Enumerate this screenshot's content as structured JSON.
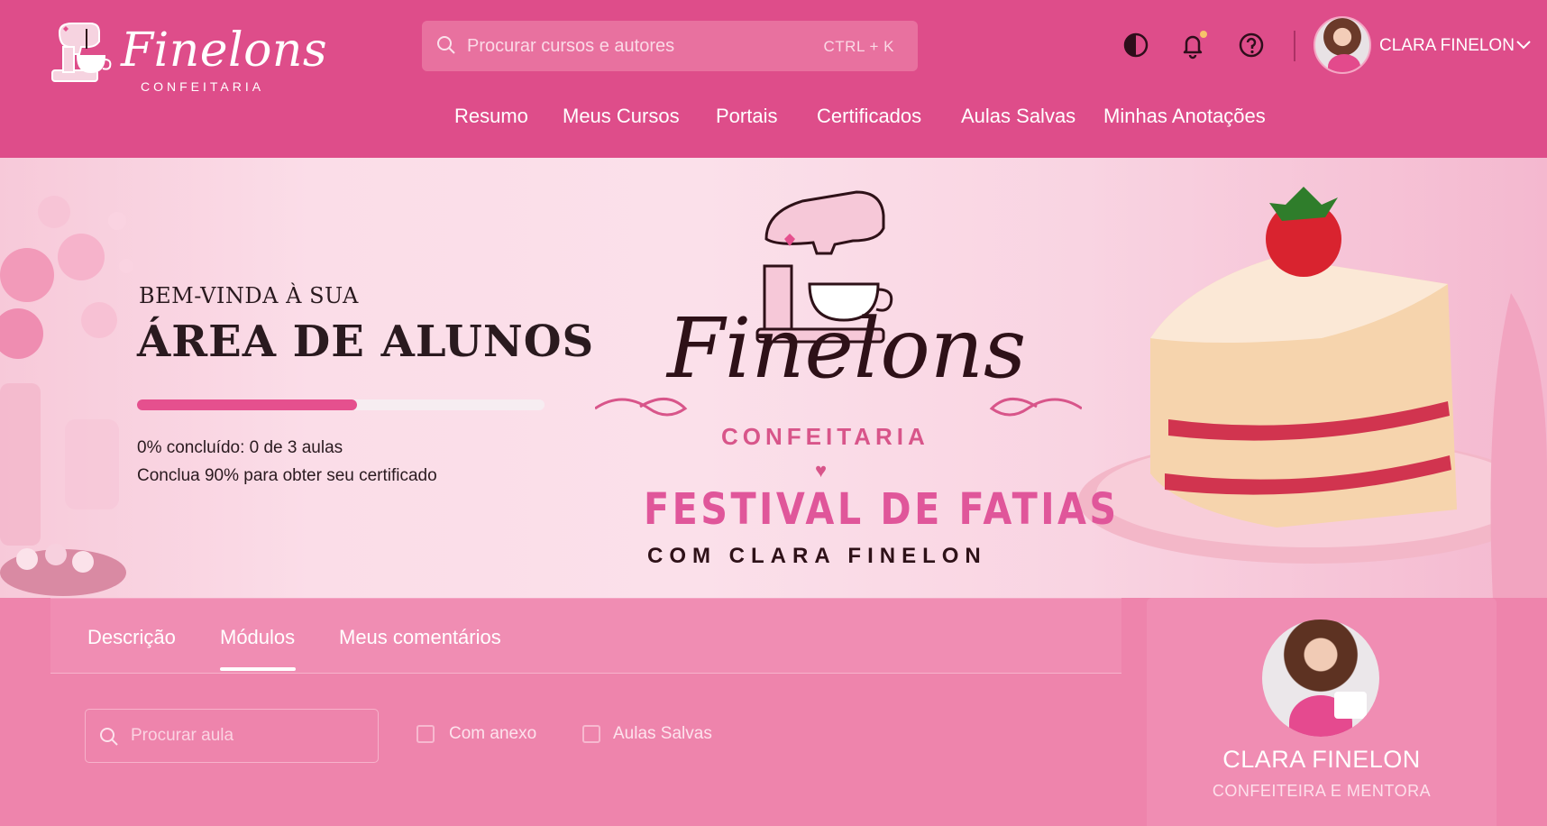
{
  "brand": {
    "name": "Finelons",
    "subtitle": "CONFEITARIA"
  },
  "search": {
    "placeholder": "Procurar cursos e autores",
    "shortcut": "CTRL + K"
  },
  "header": {
    "icons": [
      "theme-toggle-icon",
      "bell-icon",
      "help-icon"
    ],
    "user_name": "CLARA FINELON"
  },
  "nav": [
    "Resumo",
    "Meus Cursos",
    "Portais",
    "Certificados",
    "Aulas Salvas",
    "Minhas Anotações"
  ],
  "hero": {
    "welcome_small": "BEM-VINDA À SUA",
    "welcome_big": "ÁREA DE ALUNOS",
    "progress_percent": 0,
    "progress_line1": "0% concluído: 0 de 3 aulas",
    "progress_line2": "Conclua 90% para obter seu certificado",
    "banner_brand": "Finelons",
    "banner_subtitle": "CONFEITARIA",
    "banner_title": "FESTIVAL DE FATIAS",
    "banner_with": "COM CLARA FINELON"
  },
  "tabs": [
    "Descrição",
    "Módulos",
    "Meus comentários"
  ],
  "active_tab": "Módulos",
  "lessons": {
    "search_placeholder": "Procurar aula",
    "filters": [
      "Com anexo",
      "Aulas Salvas"
    ]
  },
  "mentor": {
    "name": "CLARA FINELON",
    "role": "CONFEITEIRA E MENTORA"
  },
  "colors": {
    "header": "#de4d8a",
    "accent": "#e5508e",
    "panel": "#f08db3"
  }
}
